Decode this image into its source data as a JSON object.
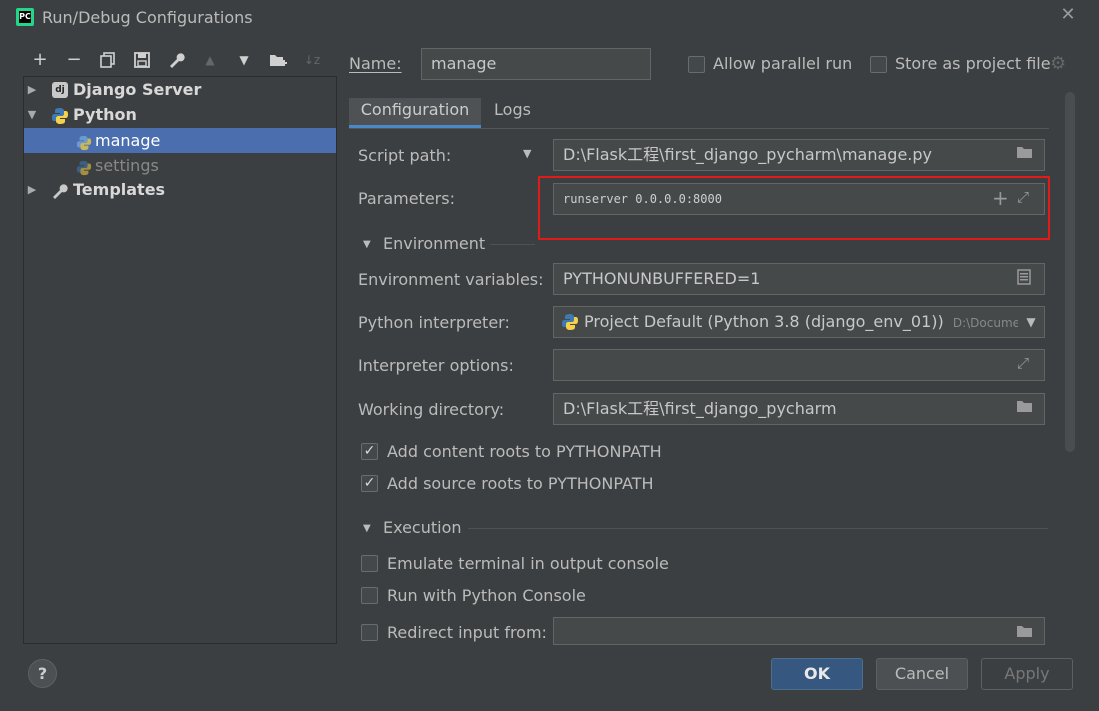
{
  "window": {
    "title": "Run/Debug Configurations",
    "app_icon": "pycharm-icon",
    "close_glyph": "✕"
  },
  "toolbar": {
    "add": "+",
    "remove": "−",
    "copy": "⧉",
    "save": "💾",
    "edit_defaults": "🔧",
    "move_up": "▲",
    "move_down": "▼",
    "new_folder": "📁",
    "sort": "↓z"
  },
  "tree": {
    "items": [
      {
        "label": "Django Server",
        "arrow": "▶",
        "icon": "django-icon"
      },
      {
        "label": "Python",
        "arrow": "▼",
        "icon": "python-icon"
      },
      {
        "label": "manage",
        "icon": "python-file-icon"
      },
      {
        "label": "settings",
        "icon": "python-file-icon"
      },
      {
        "label": "Templates",
        "arrow": "▶",
        "icon": "wrench-icon"
      }
    ]
  },
  "header": {
    "name_label": "Name:",
    "name_value": "manage",
    "allow_parallel": "Allow parallel run",
    "store_project": "Store as project file"
  },
  "tabs": [
    {
      "label": "Configuration"
    },
    {
      "label": "Logs"
    }
  ],
  "form": {
    "script_path_label": "Script path:",
    "script_path_value": "D:\\Flask工程\\first_django_pycharm\\manage.py",
    "parameters_label": "Parameters:",
    "parameters_value": "runserver 0.0.0.0:8000",
    "environment_section": "Environment",
    "env_vars_label": "Environment variables:",
    "env_vars_value": "PYTHONUNBUFFERED=1",
    "interpreter_label": "Python interpreter:",
    "interpreter_value": "Project Default (Python 3.8 (django_env_01))",
    "interpreter_path": "D:\\Documents\\",
    "interp_options_label": "Interpreter options:",
    "interp_options_value": "",
    "working_dir_label": "Working directory:",
    "working_dir_value": "D:\\Flask工程\\first_django_pycharm",
    "add_content_roots": "Add content roots to PYTHONPATH",
    "add_source_roots": "Add source roots to PYTHONPATH",
    "execution_section": "Execution",
    "emulate_terminal": "Emulate terminal in output console",
    "run_python_console": "Run with Python Console",
    "redirect_input": "Redirect input from:",
    "redirect_input_value": ""
  },
  "footer": {
    "help": "?",
    "ok": "OK",
    "cancel": "Cancel",
    "apply": "Apply"
  },
  "colors": {
    "background": "#3c3f41",
    "selection": "#4b6eaf",
    "ok_button": "#365880",
    "highlight_box": "#e21a1a"
  }
}
